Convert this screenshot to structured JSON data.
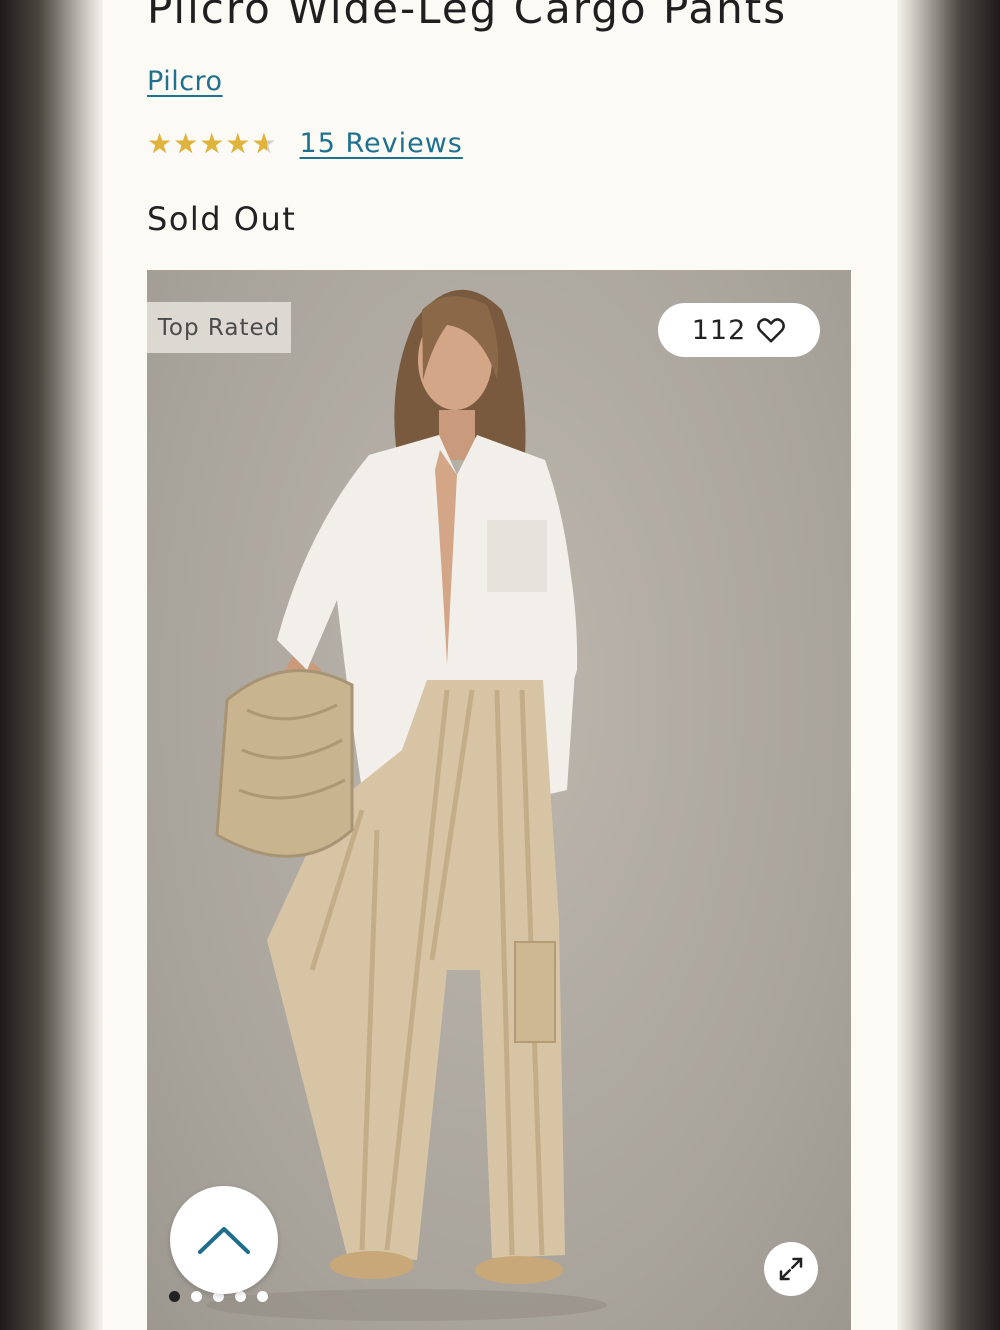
{
  "product": {
    "title": "Pilcro Wide-Leg Cargo Pants",
    "brand": "Pilcro",
    "rating": 4.6,
    "rating_max": 5,
    "stars_glyph": "★★★★★",
    "reviews_label": "15 Reviews",
    "status": "Sold Out"
  },
  "gallery": {
    "badge": "Top Rated",
    "likes": "112",
    "image_count": 5,
    "current_image": 1,
    "icons": {
      "like": "heart-icon",
      "expand": "expand-arrows-icon",
      "back_to_top": "chevron-up-icon"
    }
  },
  "colors": {
    "link": "#20708f",
    "star": "#e0b33a",
    "background": "#fbfaf5"
  }
}
